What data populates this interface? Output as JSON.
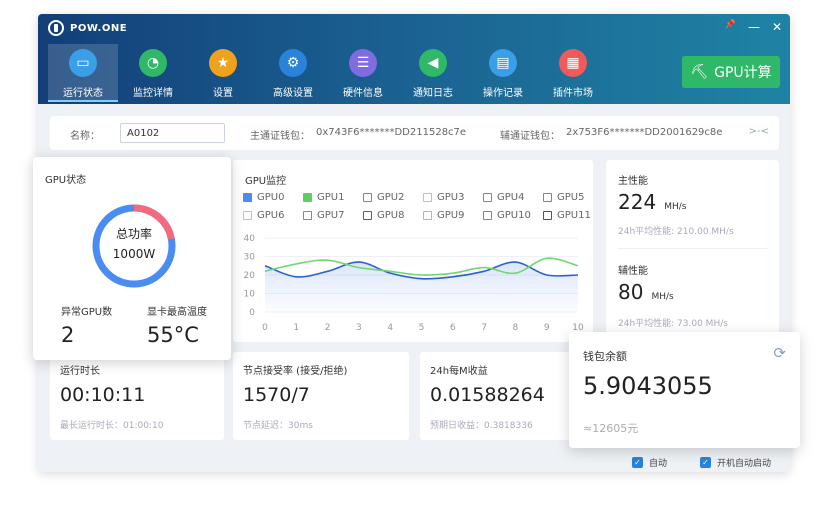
{
  "app": {
    "brand": "POW.ONE"
  },
  "window_controls": {
    "pin": "📌",
    "minimize": "—",
    "close": "✕"
  },
  "nav": {
    "items": [
      {
        "label": "运行状态",
        "icon": "monitor-icon",
        "glyph": "▭",
        "color": "#3a9ee8",
        "active": true
      },
      {
        "label": "监控详情",
        "icon": "gauge-icon",
        "glyph": "◔",
        "color": "#2fb867",
        "active": false
      },
      {
        "label": "设置",
        "icon": "medal-icon",
        "glyph": "★",
        "color": "#f0a21c",
        "active": false
      },
      {
        "label": "高级设置",
        "icon": "gear-icon",
        "glyph": "⚙",
        "color": "#2b82d9",
        "active": false
      },
      {
        "label": "硬件信息",
        "icon": "server-icon",
        "glyph": "☰",
        "color": "#7f6ce0",
        "active": false
      },
      {
        "label": "通知日志",
        "icon": "megaphone-icon",
        "glyph": "◀",
        "color": "#2fb867",
        "active": false
      },
      {
        "label": "操作记录",
        "icon": "document-icon",
        "glyph": "▤",
        "color": "#3a9ee8",
        "active": false
      },
      {
        "label": "插件市场",
        "icon": "grid-icon",
        "glyph": "▦",
        "color": "#f05a5a",
        "active": false
      }
    ]
  },
  "gpu_button": {
    "label": "GPU计算",
    "icon": "pickaxe-icon"
  },
  "infobar": {
    "name_label": "名称：",
    "name_value": "A0102",
    "main_wallet_label": "主通证钱包：",
    "main_wallet_value": "0x743F6*******DD211528c7e",
    "aux_wallet_label": "辅通证钱包：",
    "aux_wallet_value": "2x753F6*******DD2001629c8e",
    "collapse_glyph": ">-<"
  },
  "gpu_status": {
    "title": "GPU状态",
    "power_label": "总功率",
    "power_value": "1000W",
    "power_ratio": 0.22,
    "abnormal_label": "异常GPU数",
    "abnormal_value": "2",
    "max_temp_label": "显卡最高温度",
    "max_temp_value": "55°C",
    "ring_blue": "#4a8cf2",
    "ring_red": "#f26a7e"
  },
  "gpu_monitor": {
    "title": "GPU监控",
    "legend": [
      {
        "name": "GPU0",
        "color": "#4a8cf2",
        "checked": true
      },
      {
        "name": "GPU1",
        "color": "#5ccf5c",
        "checked": true
      },
      {
        "name": "GPU2",
        "color": "#4a8cf2",
        "checked": false
      },
      {
        "name": "GPU3",
        "color": "#f0c040",
        "checked": false
      },
      {
        "name": "GPU4",
        "color": "#f05a5a",
        "checked": false
      },
      {
        "name": "GPU5",
        "color": "#4a8cf2",
        "checked": false
      },
      {
        "name": "GPU6",
        "color": "#f0c040",
        "checked": false
      },
      {
        "name": "GPU7",
        "color": "#f05a5a",
        "checked": false
      },
      {
        "name": "GPU8",
        "color": "#2b6cb0",
        "checked": false
      },
      {
        "name": "GPU9",
        "color": "#7fd0c0",
        "checked": false
      },
      {
        "name": "GPU10",
        "color": "#2fb867",
        "checked": false
      },
      {
        "name": "GPU11",
        "color": "#555555",
        "checked": false
      }
    ]
  },
  "chart_data": {
    "type": "line",
    "x": [
      0,
      1,
      2,
      3,
      4,
      5,
      6,
      7,
      8,
      9,
      10
    ],
    "ylim": [
      0,
      40
    ],
    "xlim": [
      0,
      10
    ],
    "yticks": [
      0,
      10,
      20,
      30,
      40
    ],
    "grid": true,
    "series": [
      {
        "name": "GPU0",
        "color": "#2b5fd9",
        "values": [
          25,
          19,
          22,
          27,
          21,
          18,
          19,
          22,
          27,
          20,
          20
        ]
      },
      {
        "name": "GPU1",
        "color": "#6fd86f",
        "values": [
          22,
          26,
          28,
          24,
          22,
          20,
          21,
          24,
          21,
          29,
          25
        ]
      }
    ]
  },
  "main_perf": {
    "title": "主性能",
    "value": "224",
    "unit": "MH/s",
    "avg": "24h平均性能: 210.00 MH/s"
  },
  "aux_perf": {
    "title": "辅性能",
    "value": "80",
    "unit": "MH/s",
    "avg": "24h平均性能: 73.00 MH/s"
  },
  "runtime": {
    "title": "运行时长",
    "value": "00:10:11",
    "sub": "最长运行时长：01:00:10"
  },
  "node": {
    "title": "节点接受率 (接受/拒绝)",
    "value": "1570/7",
    "sub": "节点延迟：30ms"
  },
  "income": {
    "title": "24h每M收益",
    "value": "0.01588264",
    "sub": "预期日收益：0.3818336"
  },
  "wallet": {
    "title": "钱包余额",
    "value": "5.9043055",
    "sub": "≈12605元",
    "refresh": "⟳"
  },
  "statusbar": {
    "auto_label": "自动",
    "autostart_label": "开机自动启动",
    "check": "✓"
  }
}
